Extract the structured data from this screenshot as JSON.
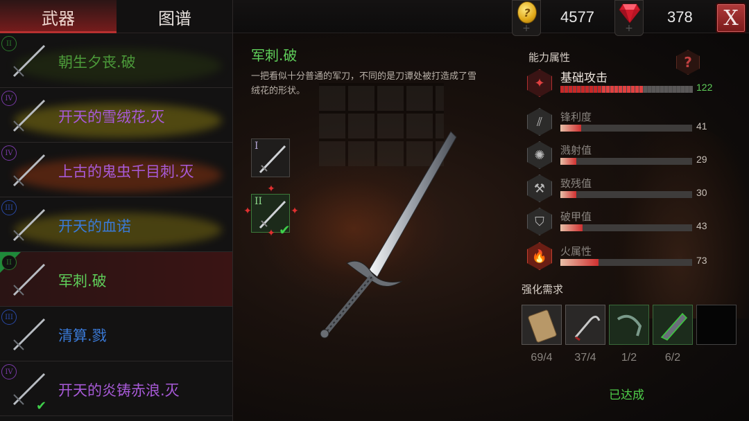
{
  "tabs": {
    "weapons": "武器",
    "codex": "图谱"
  },
  "currency": {
    "coin_value": "4577",
    "gem_value": "378",
    "coin_icon": "coin-icon",
    "gem_icon": "ruby-gem-icon",
    "add_symbol": "+"
  },
  "close_label": "X",
  "weapons": [
    {
      "rank": "II",
      "name": "朝生夕丧.破",
      "color": "#4c9a3a",
      "glow": "#2a3a10",
      "rank_color": "#2c7a2c"
    },
    {
      "rank": "IV",
      "name": "开天的雪绒花.灭",
      "color": "#a85ad8",
      "glow": "#9a8a10",
      "rank_color": "#7a3aa8"
    },
    {
      "rank": "IV",
      "name": "上古的鬼虫千目刺.灭",
      "color": "#a85ad8",
      "glow": "#a03a10",
      "rank_color": "#7a3aa8"
    },
    {
      "rank": "III",
      "name": "开天的血诺",
      "color": "#3a7ad8",
      "glow": "#8a7a10",
      "rank_color": "#2a4aa8"
    },
    {
      "rank": "II",
      "name": "军刺.破",
      "color": "#5fcf5a",
      "glow": "transparent",
      "rank_color": "#2c7a2c"
    },
    {
      "rank": "III",
      "name": "清算.戮",
      "color": "#3a7ad8",
      "glow": "transparent",
      "rank_color": "#2a4aa8"
    },
    {
      "rank": "IV",
      "name": "开天的炎铸赤浪.灭",
      "color": "#a85ad8",
      "glow": "transparent",
      "rank_color": "#7a3aa8"
    }
  ],
  "selected_index": 4,
  "equipped_index": 6,
  "detail": {
    "title": "军刺.破",
    "description": "一把看似十分普通的军刀，不同的是刀谭处被打造成了雪绒花的形状。",
    "tiers": [
      {
        "label": "I"
      },
      {
        "label": "II"
      }
    ]
  },
  "stats_title": "能力属性",
  "help_symbol": "?",
  "stats": [
    {
      "key": "base",
      "label": "基础攻击",
      "value": 122,
      "fill": 0.64,
      "icon": "attack-diamond-icon",
      "symbol": "✦"
    },
    {
      "key": "sharp",
      "label": "锋利度",
      "value": 41,
      "fill": 0.16,
      "icon": "slash-marks-icon",
      "symbol": "⫽"
    },
    {
      "key": "splash",
      "label": "溅射值",
      "value": 29,
      "fill": 0.12,
      "icon": "splash-icon",
      "symbol": "✺"
    },
    {
      "key": "crit",
      "label": "致残值",
      "value": 30,
      "fill": 0.12,
      "icon": "bone-break-icon",
      "symbol": "⚒"
    },
    {
      "key": "pierce",
      "label": "破甲值",
      "value": 43,
      "fill": 0.17,
      "icon": "broken-shield-icon",
      "symbol": "⛉"
    },
    {
      "key": "fire",
      "label": "火属性",
      "value": 73,
      "fill": 0.29,
      "icon": "flame-icon",
      "symbol": "🔥"
    }
  ],
  "enhance_title": "强化需求",
  "materials": [
    {
      "name": "wood-plank",
      "count": "69/4"
    },
    {
      "name": "sickle",
      "count": "37/4"
    },
    {
      "name": "curved-hook",
      "count": "1/2"
    },
    {
      "name": "green-blade",
      "count": "6/2"
    },
    {
      "name": "empty-slot",
      "count": ""
    }
  ],
  "status_label": "已达成"
}
